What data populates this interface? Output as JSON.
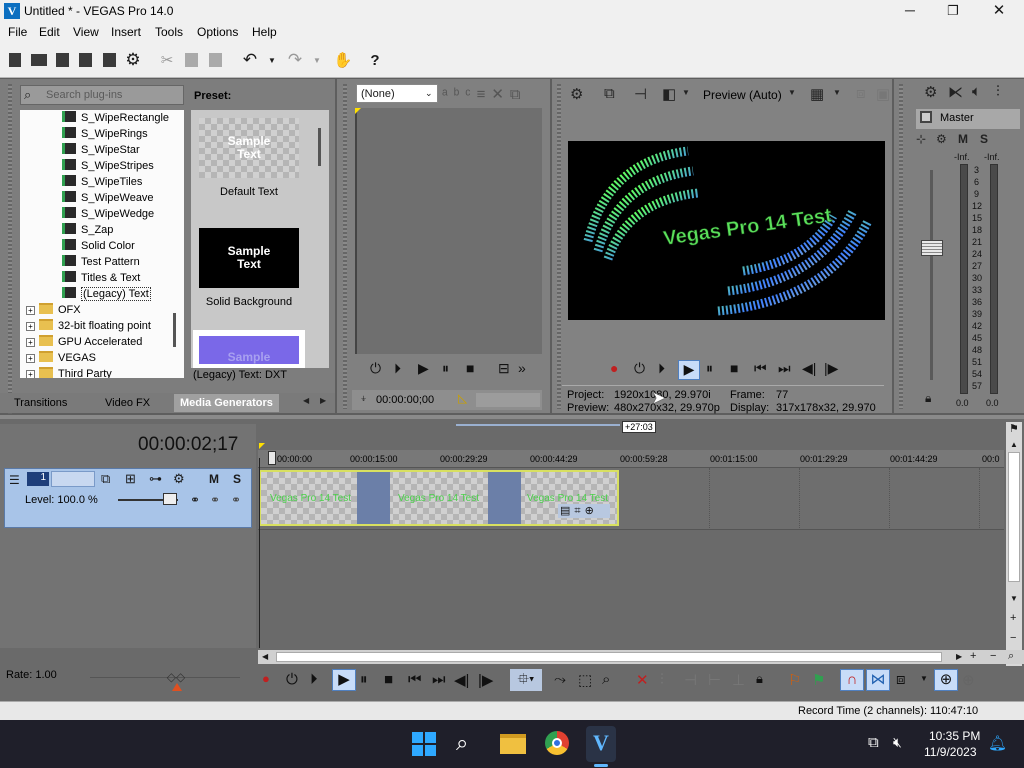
{
  "window": {
    "title": "Untitled * - VEGAS Pro 14.0",
    "controls": [
      "minimize-icon",
      "restore-icon",
      "close-icon"
    ]
  },
  "menu": [
    "File",
    "Edit",
    "View",
    "Insert",
    "Tools",
    "Options",
    "Help"
  ],
  "explorer": {
    "search_placeholder": "Search plug-ins",
    "preset_label": "Preset:",
    "tree_items": [
      {
        "label": "S_WipeRectangle",
        "type": "generator"
      },
      {
        "label": "S_WipeRings",
        "type": "generator"
      },
      {
        "label": "S_WipeStar",
        "type": "generator"
      },
      {
        "label": "S_WipeStripes",
        "type": "generator"
      },
      {
        "label": "S_WipeTiles",
        "type": "generator"
      },
      {
        "label": "S_WipeWeave",
        "type": "generator"
      },
      {
        "label": "S_WipeWedge",
        "type": "generator"
      },
      {
        "label": "S_Zap",
        "type": "generator"
      },
      {
        "label": "Solid Color",
        "type": "generator"
      },
      {
        "label": "Test Pattern",
        "type": "generator"
      },
      {
        "label": "Titles & Text",
        "type": "generator"
      },
      {
        "label": "(Legacy) Text",
        "type": "generator",
        "selected": true
      },
      {
        "label": "OFX",
        "type": "folder"
      },
      {
        "label": "32-bit floating point",
        "type": "folder"
      },
      {
        "label": "GPU Accelerated",
        "type": "folder"
      },
      {
        "label": "VEGAS",
        "type": "folder"
      },
      {
        "label": "Third Party",
        "type": "folder"
      }
    ],
    "presets": [
      {
        "thumb_text": "Sample Text",
        "caption": "Default Text"
      },
      {
        "thumb_text": "Sample Text",
        "caption": "Solid Background"
      },
      {
        "thumb_text": "Sample",
        "caption": "(Legacy) Text: DXT"
      }
    ],
    "tabs": [
      "Transitions",
      "Video FX",
      "Media Generators"
    ],
    "active_tab": "Media Generators"
  },
  "trimmer": {
    "dropdown_value": "(None)",
    "timecode": "00:00:00;00"
  },
  "preview": {
    "mode_label": "Preview (Auto)",
    "overlay_text": "Vegas Pro 14 Test",
    "project_label": "Project:",
    "project_value": "1920x1080, 29.970i",
    "preview_label": "Preview:",
    "preview_value": "480x270x32, 29.970p",
    "frame_label": "Frame:",
    "frame_value": "77",
    "display_label": "Display:",
    "display_value": "317x178x32, 29.970"
  },
  "master": {
    "title": "Master",
    "m_label": "M",
    "s_label": "S",
    "inf_left": "-Inf.",
    "inf_right": "-Inf.",
    "scale": [
      "3",
      "6",
      "9",
      "12",
      "15",
      "18",
      "21",
      "24",
      "27",
      "30",
      "33",
      "36",
      "39",
      "42",
      "45",
      "48",
      "51",
      "54",
      "57"
    ],
    "bottom_left": "0.0",
    "bottom_right": "0.0"
  },
  "timeline": {
    "cursor_time": "00:00:02;17",
    "marker": "+27:03",
    "ruler": [
      "00:00:00",
      "00:00:15:00",
      "00:00:29:29",
      "00:00:44:29",
      "00:00:59:28",
      "00:01:15:00",
      "00:01:29:29",
      "00:01:44:29",
      "00:0"
    ],
    "track_number": "1",
    "track_m": "M",
    "track_s": "S",
    "level_label": "Level: 100.0 %",
    "clip_text": "Vegas Pro 14 Test"
  },
  "transport": {
    "rate_label": "Rate: 1.00"
  },
  "status": {
    "record_time": "Record Time (2 channels): 110:47:10"
  },
  "taskbar": {
    "time": "10:35 PM",
    "date": "11/9/2023"
  },
  "colors": {
    "accent": "#0c6fc0",
    "panel": "#7a7a7a",
    "track_header": "#a8c4e8",
    "clip_border": "#d8e060",
    "gap_blue": "#6b7fa8"
  }
}
